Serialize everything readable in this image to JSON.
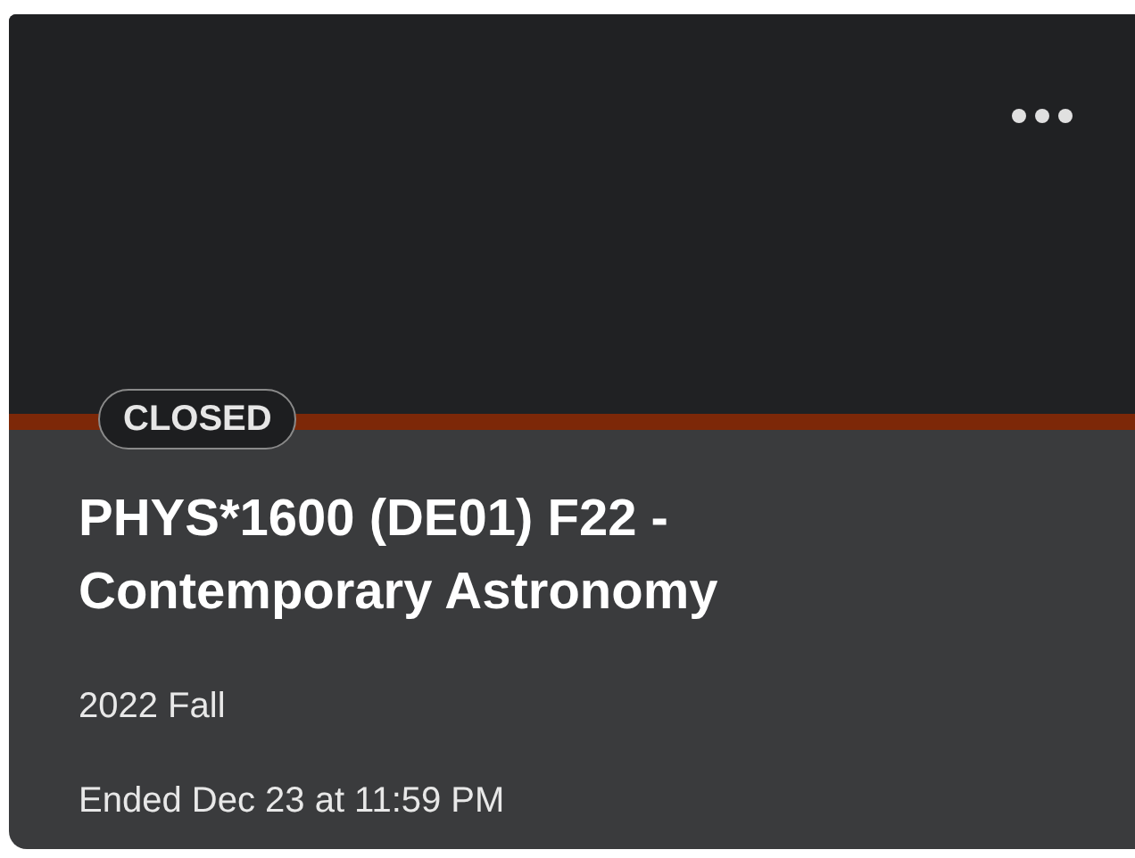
{
  "course_card": {
    "status_badge": "CLOSED",
    "title": "PHYS*1600 (DE01) F22 - Contemporary Astronomy",
    "term": "2022 Fall",
    "end_date": "Ended Dec 23 at 11:59 PM"
  }
}
